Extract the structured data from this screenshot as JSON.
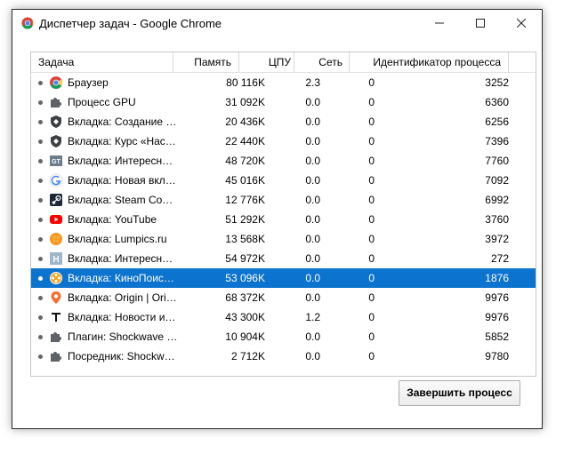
{
  "window": {
    "title": "Диспетчер задач - Google Chrome"
  },
  "table": {
    "columns": [
      "Задача",
      "Память",
      "ЦПУ",
      "Сеть",
      "Идентификатор процесса"
    ],
    "rows": [
      {
        "name": "Браузер",
        "memory": "80 116K",
        "cpu": "2.3",
        "net": "0",
        "pid": "3252",
        "icon": "chrome-icon"
      },
      {
        "name": "Процесс GPU",
        "memory": "31 092K",
        "cpu": "0.0",
        "net": "0",
        "pid": "6360",
        "icon": "puzzle-icon"
      },
      {
        "name": "Вкладка: Создание …",
        "memory": "20 436K",
        "cpu": "0.0",
        "net": "0",
        "pid": "6256",
        "icon": "shield-icon"
      },
      {
        "name": "Вкладка: Курс «Нас…",
        "memory": "22 440K",
        "cpu": "0.0",
        "net": "0",
        "pid": "7396",
        "icon": "shield-icon"
      },
      {
        "name": "Вкладка: Интересн…",
        "memory": "48 720K",
        "cpu": "0.0",
        "net": "0",
        "pid": "7760",
        "icon": "gt-icon"
      },
      {
        "name": "Вкладка: Новая вкл…",
        "memory": "45 016K",
        "cpu": "0.0",
        "net": "0",
        "pid": "7092",
        "icon": "google-icon"
      },
      {
        "name": "Вкладка: Steam Co…",
        "memory": "12 776K",
        "cpu": "0.0",
        "net": "0",
        "pid": "6992",
        "icon": "steam-icon"
      },
      {
        "name": "Вкладка: YouTube",
        "memory": "51 292K",
        "cpu": "0.0",
        "net": "0",
        "pid": "3760",
        "icon": "youtube-icon"
      },
      {
        "name": "Вкладка: Lumpics.ru",
        "memory": "13 568K",
        "cpu": "0.0",
        "net": "0",
        "pid": "3972",
        "icon": "orange-icon"
      },
      {
        "name": "Вкладка: Интересн…",
        "memory": "54 972K",
        "cpu": "0.0",
        "net": "0",
        "pid": "272",
        "icon": "h-icon"
      },
      {
        "name": "Вкладка: КиноПоис…",
        "memory": "53 096K",
        "cpu": "0.0",
        "net": "0",
        "pid": "1876",
        "icon": "film-reel-icon",
        "selected": true
      },
      {
        "name": "Вкладка: Origin | Ori…",
        "memory": "68 372K",
        "cpu": "0.0",
        "net": "0",
        "pid": "9976",
        "icon": "origin-icon"
      },
      {
        "name": "Вкладка: Новости и…",
        "memory": "43 300K",
        "cpu": "1.2",
        "net": "0",
        "pid": "9976",
        "icon": "news-icon"
      },
      {
        "name": "Плагин: Shockwave …",
        "memory": "10 904K",
        "cpu": "0.0",
        "net": "0",
        "pid": "5852",
        "icon": "puzzle-icon"
      },
      {
        "name": "Посредник: Shockw…",
        "memory": "2 712K",
        "cpu": "0.0",
        "net": "0",
        "pid": "9780",
        "icon": "puzzle-icon"
      }
    ]
  },
  "actions": {
    "end_process_label": "Завершить процесс"
  },
  "colors": {
    "selection": "#0c73cf"
  }
}
